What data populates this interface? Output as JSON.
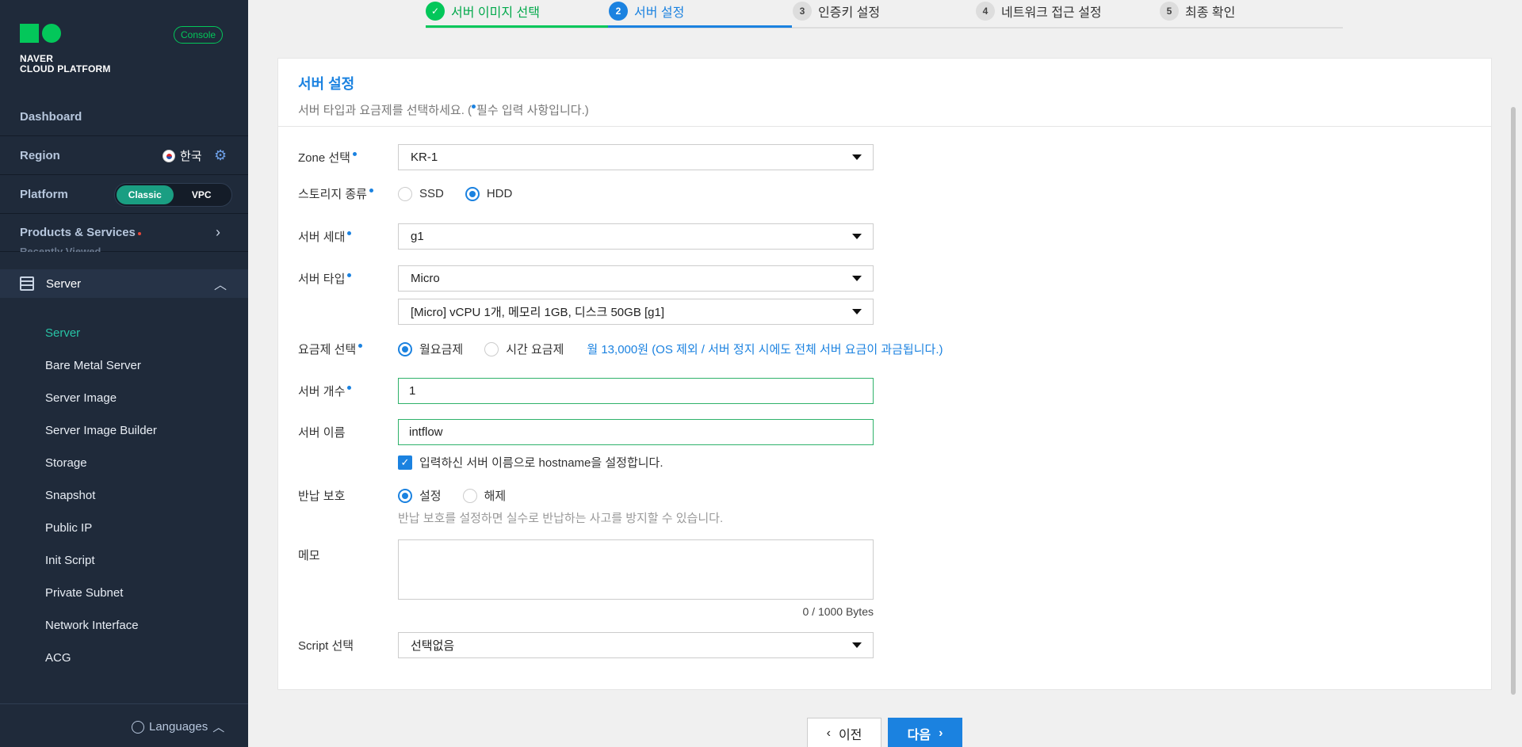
{
  "brand": {
    "line1": "NAVER",
    "line2": "CLOUD PLATFORM",
    "console": "Console"
  },
  "sidebar": {
    "dashboard": "Dashboard",
    "region_label": "Region",
    "region_value": "한국",
    "platform_label": "Platform",
    "platform_options": [
      "Classic",
      "VPC"
    ],
    "products": "Products & Services",
    "recently": "Recently Viewed",
    "server_group": "Server",
    "items": [
      "Server",
      "Bare Metal Server",
      "Server Image",
      "Server Image Builder",
      "Storage",
      "Snapshot",
      "Public IP",
      "Init Script",
      "Private Subnet",
      "Network Interface",
      "ACG"
    ],
    "languages": "Languages"
  },
  "steps": [
    {
      "num": "✓",
      "label": "서버 이미지 선택",
      "state": "done"
    },
    {
      "num": "2",
      "label": "서버 설정",
      "state": "current"
    },
    {
      "num": "3",
      "label": "인증키 설정",
      "state": "todo"
    },
    {
      "num": "4",
      "label": "네트워크 접근 설정",
      "state": "todo"
    },
    {
      "num": "5",
      "label": "최종 확인",
      "state": "todo"
    }
  ],
  "form": {
    "title": "서버 설정",
    "desc_prefix": "서버 타입과 요금제를 선택하세요. (",
    "desc_suffix": "필수 입력 사항입니다.)",
    "zone_label": "Zone 선택",
    "zone_value": "KR-1",
    "storage_label": "스토리지 종류",
    "storage_opt1": "SSD",
    "storage_opt2": "HDD",
    "gen_label": "서버 세대",
    "gen_value": "g1",
    "type_label": "서버 타입",
    "type_value": "Micro",
    "spec_value": "[Micro] vCPU 1개, 메모리 1GB, 디스크 50GB [g1]",
    "plan_label": "요금제 선택",
    "plan_opt1": "월요금제",
    "plan_opt2": "시간 요금제",
    "plan_note": "월 13,000원 (OS 제외 / 서버 정지 시에도 전체 서버 요금이 과금됩니다.)",
    "count_label": "서버 개수",
    "count_value": "1",
    "name_label": "서버 이름",
    "name_value": "intflow",
    "hostname_check": "입력하신 서버 이름으로 hostname을 설정합니다.",
    "protect_label": "반납 보호",
    "protect_opt1": "설정",
    "protect_opt2": "해제",
    "protect_hint": "반납 보호를 설정하면 실수로 반납하는 사고를 방지할 수 있습니다.",
    "memo_label": "메모",
    "memo_counter": "0 / 1000 Bytes",
    "script_label": "Script 선택",
    "script_value": "선택없음"
  },
  "buttons": {
    "prev": "이전",
    "next": "다음"
  },
  "colors": {
    "accent": "#1b82e0",
    "brand_green": "#03c75a",
    "sidebar_bg": "#1f2a3a"
  }
}
